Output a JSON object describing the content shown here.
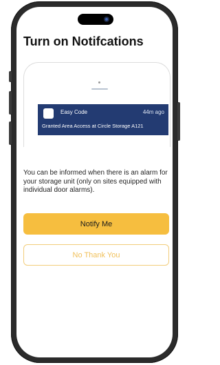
{
  "screen": {
    "title": "Turn on Notifcations",
    "notification": {
      "app_name": "Easy Code",
      "time": "44m ago",
      "message": "Granted Area Access at Circle Storage A121",
      "banner_color": "#233b72"
    },
    "description": "You can be informed when there is an alarm for your storage unit (only on sites equipped with individual door alarms).",
    "notify_button": "Notify Me",
    "decline_button": "No Thank You"
  },
  "colors": {
    "accent": "#f6be3f",
    "accent_outline": "#f2cd7a"
  }
}
